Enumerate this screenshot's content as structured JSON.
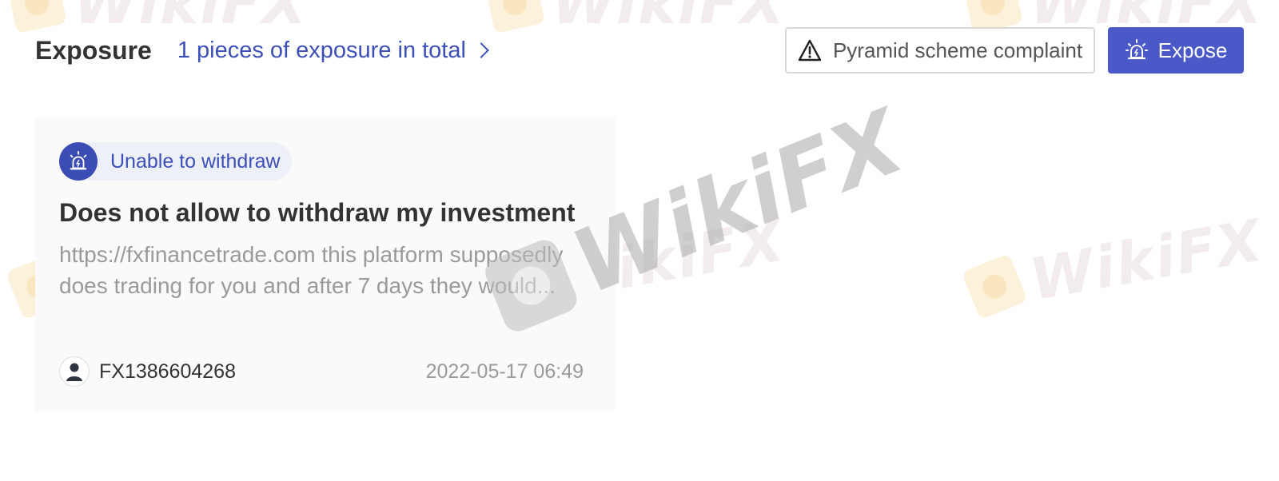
{
  "header": {
    "title": "Exposure",
    "total_link": "1 pieces of exposure in total",
    "complaint_button": "Pyramid scheme complaint",
    "expose_button": "Expose"
  },
  "watermark": {
    "text": "WikiFX"
  },
  "card": {
    "tag": "Unable to withdraw",
    "title": "Does not allow to withdraw my investment",
    "body": "https://fxfinancetrade.com this platform supposedly does trading for you and after 7 days they would...",
    "username": "FX1386604268",
    "date": "2022-05-17 06:49"
  },
  "icons": {
    "complaint": "warning-triangle-icon",
    "expose": "alarm-light-icon",
    "tag": "alarm-light-icon",
    "link": "chevron-right-icon",
    "avatar": "user-avatar-icon"
  },
  "colors": {
    "accent": "#4a59c7",
    "link": "#3d4fb8",
    "card_bg": "#fafafa"
  }
}
